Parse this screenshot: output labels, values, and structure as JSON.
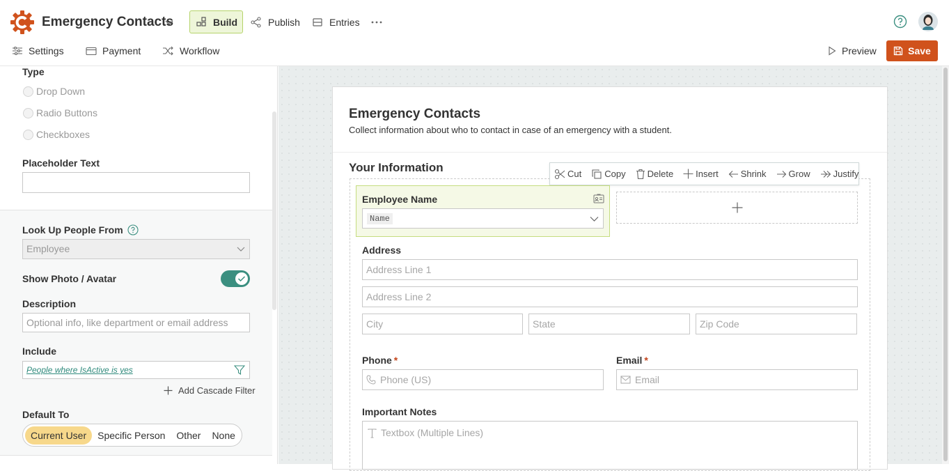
{
  "app": {
    "title": "Emergency Contacts"
  },
  "topnav": {
    "build": "Build",
    "publish": "Publish",
    "entries": "Entries"
  },
  "subnav": {
    "settings": "Settings",
    "payment": "Payment",
    "workflow": "Workflow",
    "preview": "Preview",
    "save": "Save"
  },
  "colors": {
    "brand": "#d0521c",
    "accent": "#3b8f80",
    "build_bg": "#eef6d9",
    "selected_field": "#f5f9e6"
  },
  "left": {
    "type_label": "Type",
    "type_options": [
      "Drop Down",
      "Radio Buttons",
      "Checkboxes"
    ],
    "placeholder_label": "Placeholder Text",
    "placeholder_value": "",
    "lookup_label": "Look Up People From",
    "lookup_value": "Employee",
    "show_photo_label": "Show Photo / Avatar",
    "show_photo_on": true,
    "description_label": "Description",
    "description_placeholder": "Optional info, like department or email address",
    "include_label": "Include",
    "include_filter": "People where IsActive is yes",
    "add_cascade": "Add Cascade Filter",
    "default_label": "Default To",
    "default_options": [
      "Current User",
      "Specific Person",
      "Other",
      "None"
    ],
    "default_selected": "Current User"
  },
  "form": {
    "title": "Emergency Contacts",
    "description": "Collect information about who to contact in case of an emergency with a student.",
    "section_title": "Your Information",
    "toolbar": [
      "Cut",
      "Copy",
      "Delete",
      "Insert",
      "Shrink",
      "Grow",
      "Justify"
    ],
    "employee_label": "Employee Name",
    "employee_tag": "Name",
    "address_label": "Address",
    "address_line1": "Address Line 1",
    "address_line2": "Address Line 2",
    "city": "City",
    "state": "State",
    "zip": "Zip Code",
    "phone_label": "Phone",
    "phone_placeholder": "Phone (US)",
    "email_label": "Email",
    "email_placeholder": "Email",
    "required_mark": "*",
    "notes_label": "Important Notes",
    "notes_placeholder": "Textbox (Multiple Lines)"
  }
}
